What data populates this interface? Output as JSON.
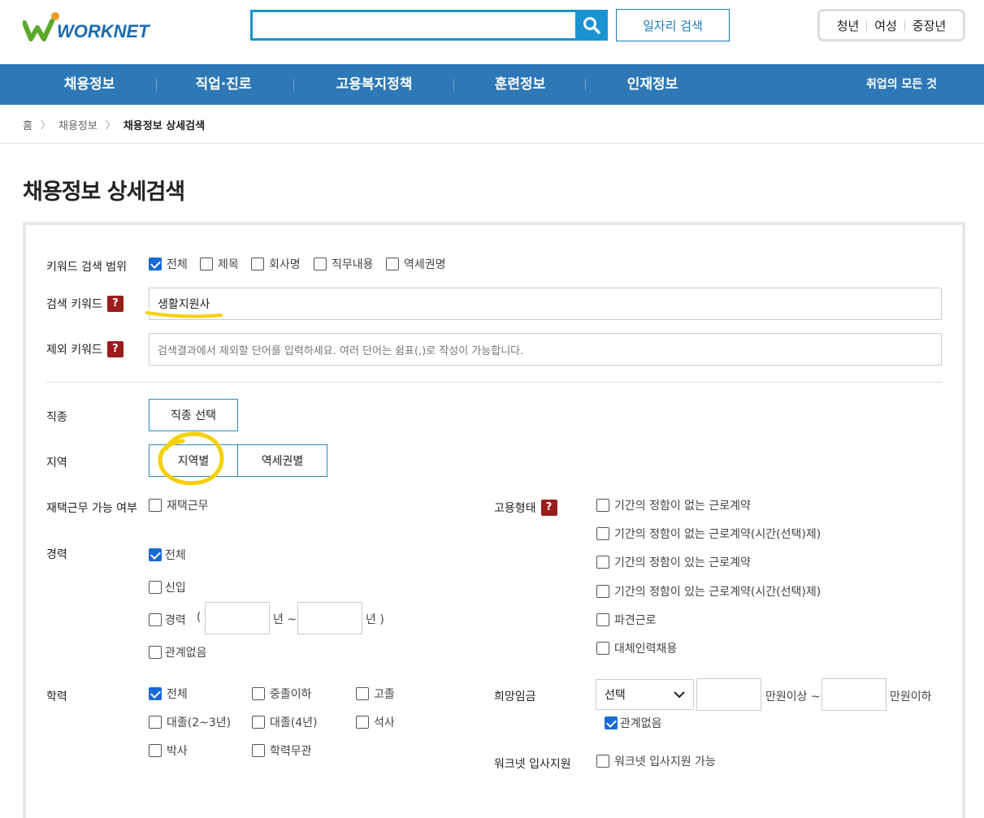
{
  "header": {
    "logo_text": "WORKNET",
    "search_value": "",
    "job_search_label": "일자리 검색",
    "targets": [
      "청년",
      "여성",
      "중장년"
    ]
  },
  "gnb": {
    "items": [
      "채용정보",
      "직업·진로",
      "고용복지정책",
      "훈련정보",
      "인재정보"
    ],
    "all_label": "취업의 모든 것"
  },
  "breadcrumb": {
    "home": "홈",
    "level1": "채용정보",
    "current": "채용정보 상세검색"
  },
  "page_title": "채용정보 상세검색",
  "keyword_scope": {
    "label": "키워드 검색 범위",
    "options": [
      {
        "label": "전체",
        "checked": true
      },
      {
        "label": "제목",
        "checked": false
      },
      {
        "label": "회사명",
        "checked": false
      },
      {
        "label": "직무내용",
        "checked": false
      },
      {
        "label": "역세권명",
        "checked": false
      }
    ]
  },
  "search_keyword": {
    "label": "검색 키워드",
    "value": "생활지원사"
  },
  "exclude_keyword": {
    "label": "제외 키워드",
    "placeholder": "검색결과에서 제외할 단어를 입력하세요. 여러 단어는 쉼표(,)로 작성이 가능합니다."
  },
  "help_glyph": "?",
  "occupation": {
    "label": "직종",
    "button": "직종 선택"
  },
  "region": {
    "label": "지역",
    "tabs": [
      "지역별",
      "역세권별"
    ]
  },
  "remote": {
    "label": "재택근무 가능 여부",
    "option": {
      "label": "재택근무",
      "checked": false
    }
  },
  "career": {
    "label": "경력",
    "options": [
      {
        "label": "전체",
        "checked": true
      },
      {
        "label": "신입",
        "checked": false
      },
      {
        "label": "경력",
        "checked": false
      },
      {
        "label": "관계없음",
        "checked": false
      }
    ],
    "paren_open": "(",
    "year_from_unit": "년 ~",
    "year_to_unit": "년 )"
  },
  "education": {
    "label": "학력",
    "options": [
      {
        "label": "전체",
        "checked": true
      },
      {
        "label": "중졸이하",
        "checked": false
      },
      {
        "label": "고졸",
        "checked": false
      },
      {
        "label": "대졸(2~3년)",
        "checked": false
      },
      {
        "label": "대졸(4년)",
        "checked": false
      },
      {
        "label": "석사",
        "checked": false
      },
      {
        "label": "박사",
        "checked": false
      },
      {
        "label": "학력무관",
        "checked": false
      }
    ]
  },
  "employment_type": {
    "label": "고용형태",
    "options": [
      {
        "label": "기간의 정함이 없는 근로계약",
        "checked": false
      },
      {
        "label": "기간의 정함이 없는 근로계약(시간(선택)제)",
        "checked": false
      },
      {
        "label": "기간의 정함이 있는 근로계약",
        "checked": false
      },
      {
        "label": "기간의 정함이 있는 근로계약(시간(선택)제)",
        "checked": false
      },
      {
        "label": "파견근로",
        "checked": false
      },
      {
        "label": "대체인력채용",
        "checked": false
      }
    ]
  },
  "salary": {
    "label": "희망임금",
    "select_value": "선택",
    "min_unit": "만원이상 ~",
    "max_unit": "만원이하",
    "any_option": {
      "label": "관계없음",
      "checked": true
    }
  },
  "worknet_support": {
    "label": "워크넷 입사지원",
    "option": {
      "label": "워크넷 입사지원 가능",
      "checked": false
    }
  },
  "colors": {
    "gnb_bg": "#2d78b5",
    "search_accent": "#1a93d1",
    "checkbox_on": "#1a6ad6",
    "help_bg": "#9b1c1c",
    "annotation": "#f7d000"
  }
}
